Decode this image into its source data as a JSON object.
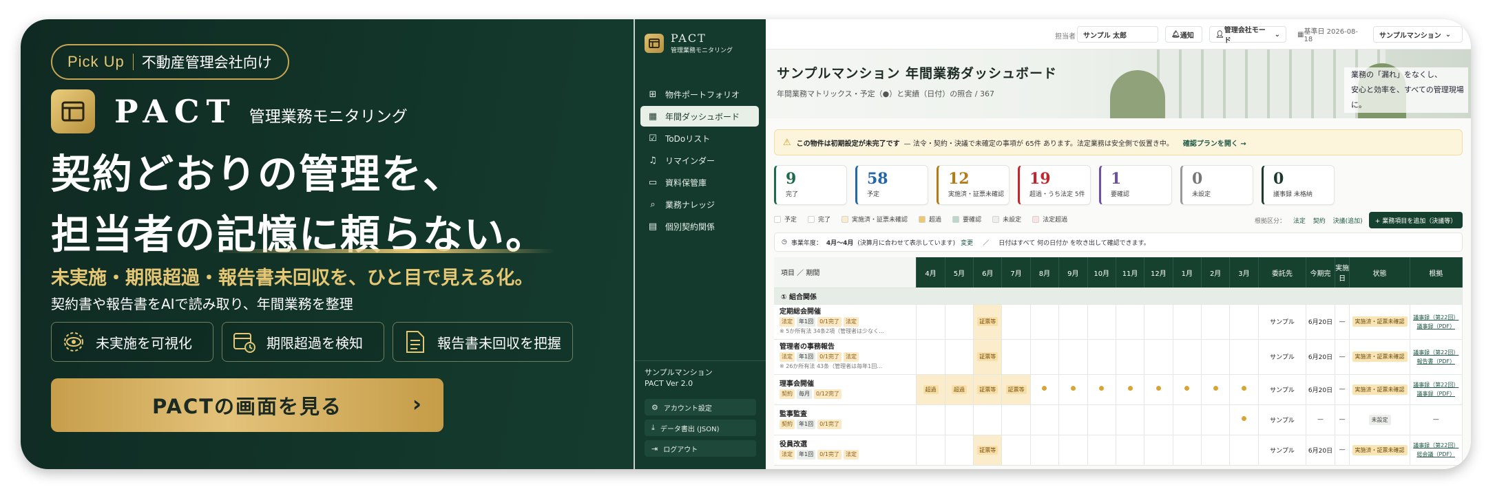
{
  "banner": {
    "pill_gold": "Pick Up",
    "pill_text": "不動産管理会社向け",
    "brand_name": "PACT",
    "brand_sub": "管理業務モニタリング",
    "headline_1": "契約どおりの管理を、",
    "headline_2": "担当者の記憶に頼らない。",
    "gold_line": "未実施・期限超過・報告書未回収を、ひと目で見える化。",
    "sub_line": "契約書や報告書をAIで読み取り、年間業務を整理",
    "features": [
      "未実施を可視化",
      "期限超過を検知",
      "報告書未回収を把握"
    ],
    "cta": "PACTの画面を見る",
    "accent": "#e5c774"
  },
  "sidebar": {
    "title": "PACT",
    "subtitle": "管理業務モニタリング",
    "items": [
      {
        "label": "物件ポートフォリオ",
        "icon": "grid-icon"
      },
      {
        "label": "年間ダッシュボード",
        "icon": "calendar-icon"
      },
      {
        "label": "ToDoリスト",
        "icon": "checkbox-icon"
      },
      {
        "label": "リマインダー",
        "icon": "bell-icon"
      },
      {
        "label": "資料保管庫",
        "icon": "folder-icon"
      },
      {
        "label": "業務ナレッジ",
        "icon": "search-icon"
      },
      {
        "label": "個別契約関係",
        "icon": "table-icon"
      }
    ],
    "property": "サンプルマンション",
    "version": "PACT Ver 2.0",
    "buttons": [
      "アカウント設定",
      "データ書出 (JSON)",
      "ログアウト"
    ]
  },
  "topbar": {
    "manager_label": "担当者",
    "manager_value": "サンプル 太郎",
    "notify": "通知",
    "mode": "管理会社モード",
    "date_label": "基準日 2026-08-18",
    "property": "サンプルマンション"
  },
  "hero": {
    "title": "サンプルマンション 年間業務ダッシュボード",
    "subtitle": "年間業務マトリックス・予定（●）と実績（日付）の照合 / 367",
    "slogan_1": "業務の「漏れ」をなくし、",
    "slogan_2": "安心と効率を、すべての管理現場に。"
  },
  "warning": {
    "bold": "この物件は初期設定が未完了です",
    "text": "— 法令・契約・決議で未確定の事項が 65件 あります。法定業務は安全側で仮置き中。",
    "link": "確認プランを開く →"
  },
  "kpis": [
    {
      "value": "9",
      "label": "完了",
      "color": "#1e6a4c"
    },
    {
      "value": "58",
      "label": "予定",
      "color": "#2467a8"
    },
    {
      "value": "12",
      "label": "実施済・証票未確認",
      "color": "#b47a14"
    },
    {
      "value": "19",
      "label": "超過・うち法定 5件",
      "color": "#c0262b"
    },
    {
      "value": "1",
      "label": "要確認",
      "color": "#6c4fa3"
    },
    {
      "value": "0",
      "label": "未設定",
      "color": "#777777"
    },
    {
      "value": "0",
      "label": "議事録 未格納",
      "color": "#1b3a2d"
    }
  ],
  "legend": [
    "予定",
    "完了",
    "実施済・証票未確認",
    "超過",
    "要確認",
    "未設定",
    "法定超過"
  ],
  "legend_colors": [
    "#ffffff",
    "#ffffff",
    "#fbeccb",
    "#f1c76d",
    "#bcd6c8",
    "#eeeeee",
    "#fde2e2"
  ],
  "division": {
    "label": "根拠区分：",
    "items": [
      "法定",
      "契約",
      "決議(追加)"
    ]
  },
  "add_button": "+ 業務項目を追加（決議等）",
  "period": {
    "label": "事業年度：",
    "range": "4月〜4月",
    "note": "(決算月に合わせて表示しています)",
    "change": "変更",
    "note2": "日付はすべて 何の日付か を吹き出して確認できます。"
  },
  "table": {
    "first_header": "項目 ／ 期間",
    "months": [
      "4月",
      "5月",
      "6月",
      "7月",
      "8月",
      "9月",
      "10月",
      "11月",
      "12月",
      "1月",
      "2月",
      "3月"
    ],
    "extra_headers": [
      "委託先",
      "今期完",
      "実施日",
      "状態",
      "根拠"
    ],
    "group": "① 組合関係",
    "rows": [
      {
        "name": "定期総会開催",
        "tags": [
          "法定",
          "年1回",
          "0/1完了",
          "法定"
        ],
        "note": "※ 5か所有法 34条2項（管理者は少なく…",
        "vendor": "サンプル",
        "due": "6月20日",
        "date": "—",
        "status": "実施済・証票未確認",
        "ref1": "議事録（第22回）",
        "ref2": "議事録（PDF）"
      },
      {
        "name": "管理者の事務報告",
        "tags": [
          "法定",
          "年1回",
          "0/1完了",
          "法定"
        ],
        "note": "※ 26か所有法 43条（管理者は毎年1回…",
        "vendor": "サンプル",
        "due": "6月20日",
        "date": "—",
        "status": "実施済・証票未確認",
        "ref1": "議事録（第22回）",
        "ref2": "報告書（PDF）"
      },
      {
        "name": "理事会開催",
        "tags": [
          "契約",
          "毎月",
          "0/12完了"
        ],
        "note": "",
        "vendor": "サンプル",
        "due": "6月20日",
        "date": "—",
        "status": "実施済・証票未確認",
        "ref1": "議事録（第22回）",
        "ref2": "議事録（PDF）"
      },
      {
        "name": "監事監査",
        "tags": [
          "契約",
          "年1回",
          "0/1完了"
        ],
        "note": "",
        "vendor": "サンプル",
        "due": "—",
        "date": "—",
        "status": "未設定",
        "ref1": "—",
        "ref2": ""
      },
      {
        "name": "役員改選",
        "tags": [
          "法定",
          "年1回",
          "0/1完了",
          "法定"
        ],
        "note": "",
        "vendor": "サンプル",
        "due": "6月20日",
        "date": "—",
        "status": "実施済・証票未確認",
        "ref1": "議事録（第22回）",
        "ref2": "総会議（PDF）"
      }
    ],
    "cell_mark": "証票等",
    "over_mark": "超過"
  }
}
